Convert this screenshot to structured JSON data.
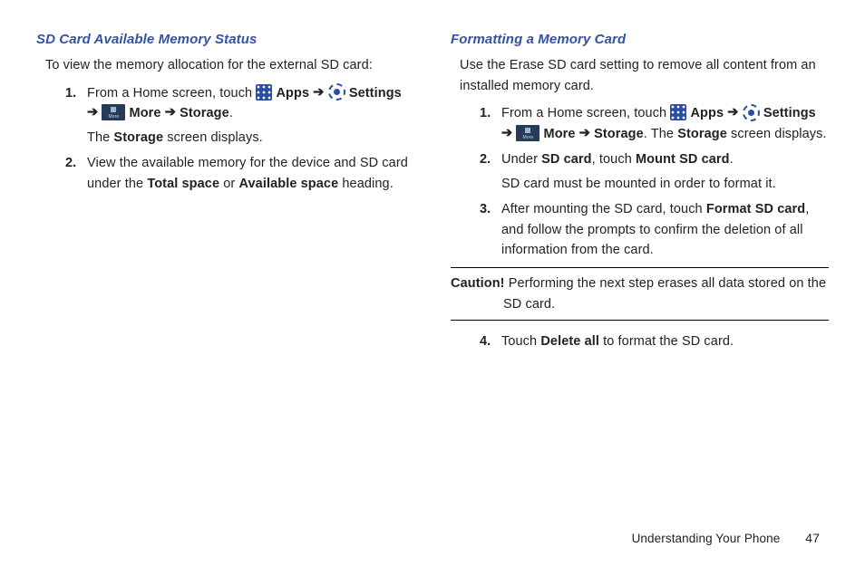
{
  "left": {
    "heading": "SD Card Available Memory Status",
    "intro": "To view the memory allocation for the external SD card:",
    "step1_num": "1.",
    "step1_a": "From a Home screen, touch ",
    "apps_label": "Apps",
    "arrow": " ➔ ",
    "settings_label": "Settings",
    "more_label": "More",
    "storage_label": "Storage",
    "period": ".",
    "step1_b": "The ",
    "step1_b2": " screen displays.",
    "step2_num": "2.",
    "step2_a": "View the available memory for the device and SD card under the ",
    "total_space": "Total space",
    "or_text": " or ",
    "available_space": "Available space",
    "heading_text": " heading."
  },
  "right": {
    "heading": "Formatting a Memory Card",
    "intro": "Use the Erase SD card setting to remove all content from an installed memory card.",
    "step1_num": "1.",
    "step1_a": "From a Home screen, touch ",
    "apps_label": "Apps",
    "arrow": " ➔ ",
    "settings_label": "Settings",
    "more_label": "More",
    "storage_label": "Storage",
    "step1_b": ". The ",
    "step1_b2": " screen displays.",
    "step2_num": "2.",
    "step2_a": "Under ",
    "sd_card": "SD card",
    "touch_text": ", touch ",
    "mount_sd": "Mount SD card",
    "period": ".",
    "step2_b": "SD card must be mounted in order to format it.",
    "step3_num": "3.",
    "step3_a": "After mounting the SD card, touch ",
    "format_sd": "Format SD card",
    "step3_b": ", and follow the prompts to confirm the deletion of all information from the card.",
    "caution_label": "Caution! ",
    "caution_text": "Performing the next step erases all data stored on the SD card.",
    "step4_num": "4.",
    "step4_a": "Touch ",
    "delete_all": "Delete all",
    "step4_b": " to format the SD card."
  },
  "footer": {
    "section": "Understanding Your Phone",
    "page": "47"
  }
}
